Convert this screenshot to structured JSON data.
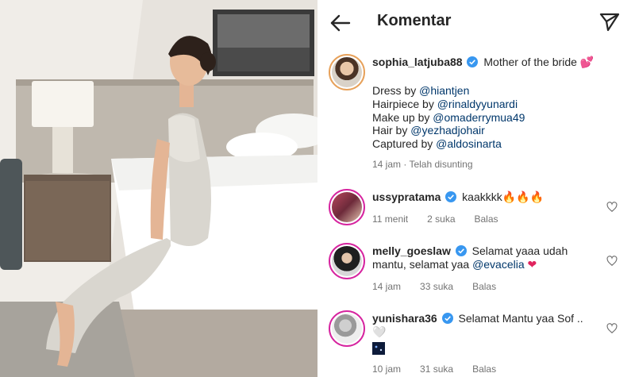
{
  "header": {
    "title": "Komentar"
  },
  "caption": {
    "username": "sophia_latjuba88",
    "text": "Mother of the bride",
    "emoji": "💕",
    "lines": [
      {
        "prefix": "Dress by ",
        "mention": "@hiantjen"
      },
      {
        "prefix": "Hairpiece by ",
        "mention": "@rinaldyyunardi"
      },
      {
        "prefix": "Make up by ",
        "mention": "@omaderrymua49"
      },
      {
        "prefix": "Hair by ",
        "mention": "@yezhadjohair"
      },
      {
        "prefix": "Captured by ",
        "mention": "@aldosinarta"
      }
    ],
    "meta": "14 jam · Telah disunting"
  },
  "comments": [
    {
      "username": "ussypratama",
      "text": "kaakkkk",
      "emoji": "🔥🔥🔥",
      "time": "11 menit",
      "likes": "2 suka",
      "reply": "Balas"
    },
    {
      "username": "melly_goeslaw",
      "text": "Selamat yaaa udah mantu, selamat yaa",
      "mention": "@evacelia",
      "emoji": "❤",
      "time": "14 jam",
      "likes": "33 suka",
      "reply": "Balas"
    },
    {
      "username": "yunishara36",
      "text": "Selamat Mantu yaa Sof ..",
      "emoji": "🤍",
      "time": "10 jam",
      "likes": "31 suka",
      "reply": "Balas"
    }
  ],
  "colors": {
    "text": "#262626",
    "mention": "#00376b",
    "muted": "#737373",
    "verified": "#3897f0"
  }
}
